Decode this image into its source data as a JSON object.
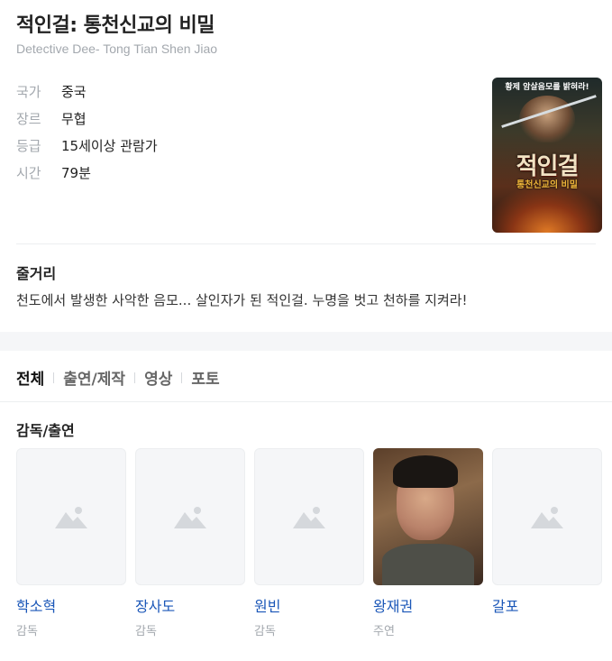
{
  "movie": {
    "title": "적인걸: 통천신교의 비밀",
    "subtitle": "Detective Dee- Tong Tian Shen Jiao"
  },
  "info": [
    {
      "label": "국가",
      "value": "중국"
    },
    {
      "label": "장르",
      "value": "무협"
    },
    {
      "label": "등급",
      "value": "15세이상 관람가"
    },
    {
      "label": "시간",
      "value": "79분"
    }
  ],
  "poster": {
    "tagline": "황제 암살음모를 밝혀라!",
    "title": "적인걸",
    "subtitle": "통천신교의 비밀"
  },
  "synopsis": {
    "heading": "줄거리",
    "text": "천도에서 발생한 사악한 음모... 살인자가 된 적인걸. 누명을 벗고 천하를 지켜라!"
  },
  "tabs": [
    {
      "label": "전체",
      "active": true
    },
    {
      "label": "출연/제작",
      "active": false
    },
    {
      "label": "영상",
      "active": false
    },
    {
      "label": "포토",
      "active": false
    }
  ],
  "cast_section": {
    "heading": "감독/출연",
    "people": [
      {
        "name": "학소혁",
        "role": "감독",
        "photo": "placeholder-image-icon"
      },
      {
        "name": "장사도",
        "role": "감독",
        "photo": "placeholder-image-icon"
      },
      {
        "name": "원빈",
        "role": "감독",
        "photo": "placeholder-image-icon"
      },
      {
        "name": "왕재권",
        "role": "주연",
        "photo": "portrait"
      },
      {
        "name": "갈포",
        "role": "",
        "photo": "placeholder-image-icon"
      }
    ]
  },
  "colors": {
    "link": "#1b57b8",
    "muted": "#a3a8ae",
    "background": "#f5f6f8"
  }
}
